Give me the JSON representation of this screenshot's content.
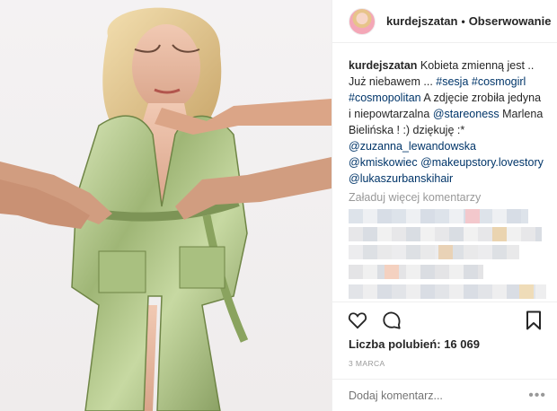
{
  "post": {
    "username": "kurdejszatan",
    "separator": "•",
    "follow_label": "Obserwowanie",
    "caption": {
      "username": "kurdejszatan",
      "part1": " Kobieta zmienną jest .. Już niebawem ... ",
      "tag_sesja": "#sesja",
      "tag_cosmogirl": "#cosmogirl",
      "tag_cosmopolitan": "#cosmopolitan",
      "part2": " A zdjęcie zrobiła jedyna i niepowtarzalna ",
      "mention_stareoness": "@stareoness",
      "part3": " Marlena Bielińska ! :) dziękuję :* ",
      "mention_zuzanna": "@zuzanna_lewandowska",
      "mention_kmiskowiec": "@kmiskowiec",
      "mention_makeup": "@makeupstory.lovestory",
      "mention_lukasz": "@lukaszurbanskihair"
    },
    "load_more": "Załaduj więcej komentarzy",
    "likes_label": "Liczba polubień:",
    "likes_count": "16 069",
    "date": "3 MARCA",
    "add_comment_placeholder": "Dodaj komentarz...",
    "more_options": "•••"
  },
  "icons": {
    "like": "heart-icon",
    "comment": "comment-bubble-icon",
    "save": "bookmark-icon",
    "options": "more-dots-icon"
  },
  "colors": {
    "link": "#003569",
    "muted": "#999999",
    "text": "#262626",
    "border": "#efefef"
  }
}
